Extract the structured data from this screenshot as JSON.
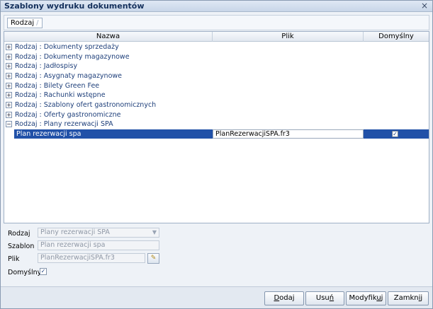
{
  "window": {
    "title": "Szablony wydruku dokumentów",
    "close_glyph": "×"
  },
  "group_chip": {
    "label": "Rodzaj",
    "arrow": "/"
  },
  "grid": {
    "headers": {
      "name": "Nazwa",
      "file": "Plik",
      "default": "Domyślny"
    },
    "groups": [
      {
        "expander": "+",
        "label": "Rodzaj : Dokumenty sprzedaży"
      },
      {
        "expander": "+",
        "label": "Rodzaj : Dokumenty magazynowe"
      },
      {
        "expander": "+",
        "label": "Rodzaj : Jadłospisy"
      },
      {
        "expander": "+",
        "label": "Rodzaj : Asygnaty magazynowe"
      },
      {
        "expander": "+",
        "label": "Rodzaj : Bilety Green Fee"
      },
      {
        "expander": "+",
        "label": "Rodzaj : Rachunki wstępne"
      },
      {
        "expander": "+",
        "label": "Rodzaj : Szablony ofert gastronomicznych"
      },
      {
        "expander": "+",
        "label": "Rodzaj : Oferty gastronomiczne"
      },
      {
        "expander": "−",
        "label": "Rodzaj : Plany rezerwacji SPA"
      }
    ],
    "selected_row": {
      "name": "Plan rezerwacji spa",
      "file": "PlanRezerwacjiSPA.fr3",
      "default_check": "✓"
    }
  },
  "form": {
    "rodzaj": {
      "label": "Rodzaj",
      "value": "Plany rezerwacji SPA",
      "dropdown_glyph": "▼"
    },
    "szablon": {
      "label": "Szablon",
      "value": "Plan rezerwacji spa"
    },
    "plik": {
      "label": "Plik",
      "value": "PlanRezerwacjiSPA.fr3",
      "pick_glyph": "✎"
    },
    "domyslny": {
      "label": "Domyślny",
      "check": "✓"
    }
  },
  "buttons": {
    "add": {
      "u": "D",
      "rest": "odaj"
    },
    "delete": {
      "pre": "Usu",
      "u": "ń",
      "rest": ""
    },
    "modify": {
      "pre": "Modyfik",
      "u": "u",
      "rest": "j"
    },
    "close": {
      "pre": "Zamkn",
      "u": "i",
      "rest": "j"
    }
  }
}
